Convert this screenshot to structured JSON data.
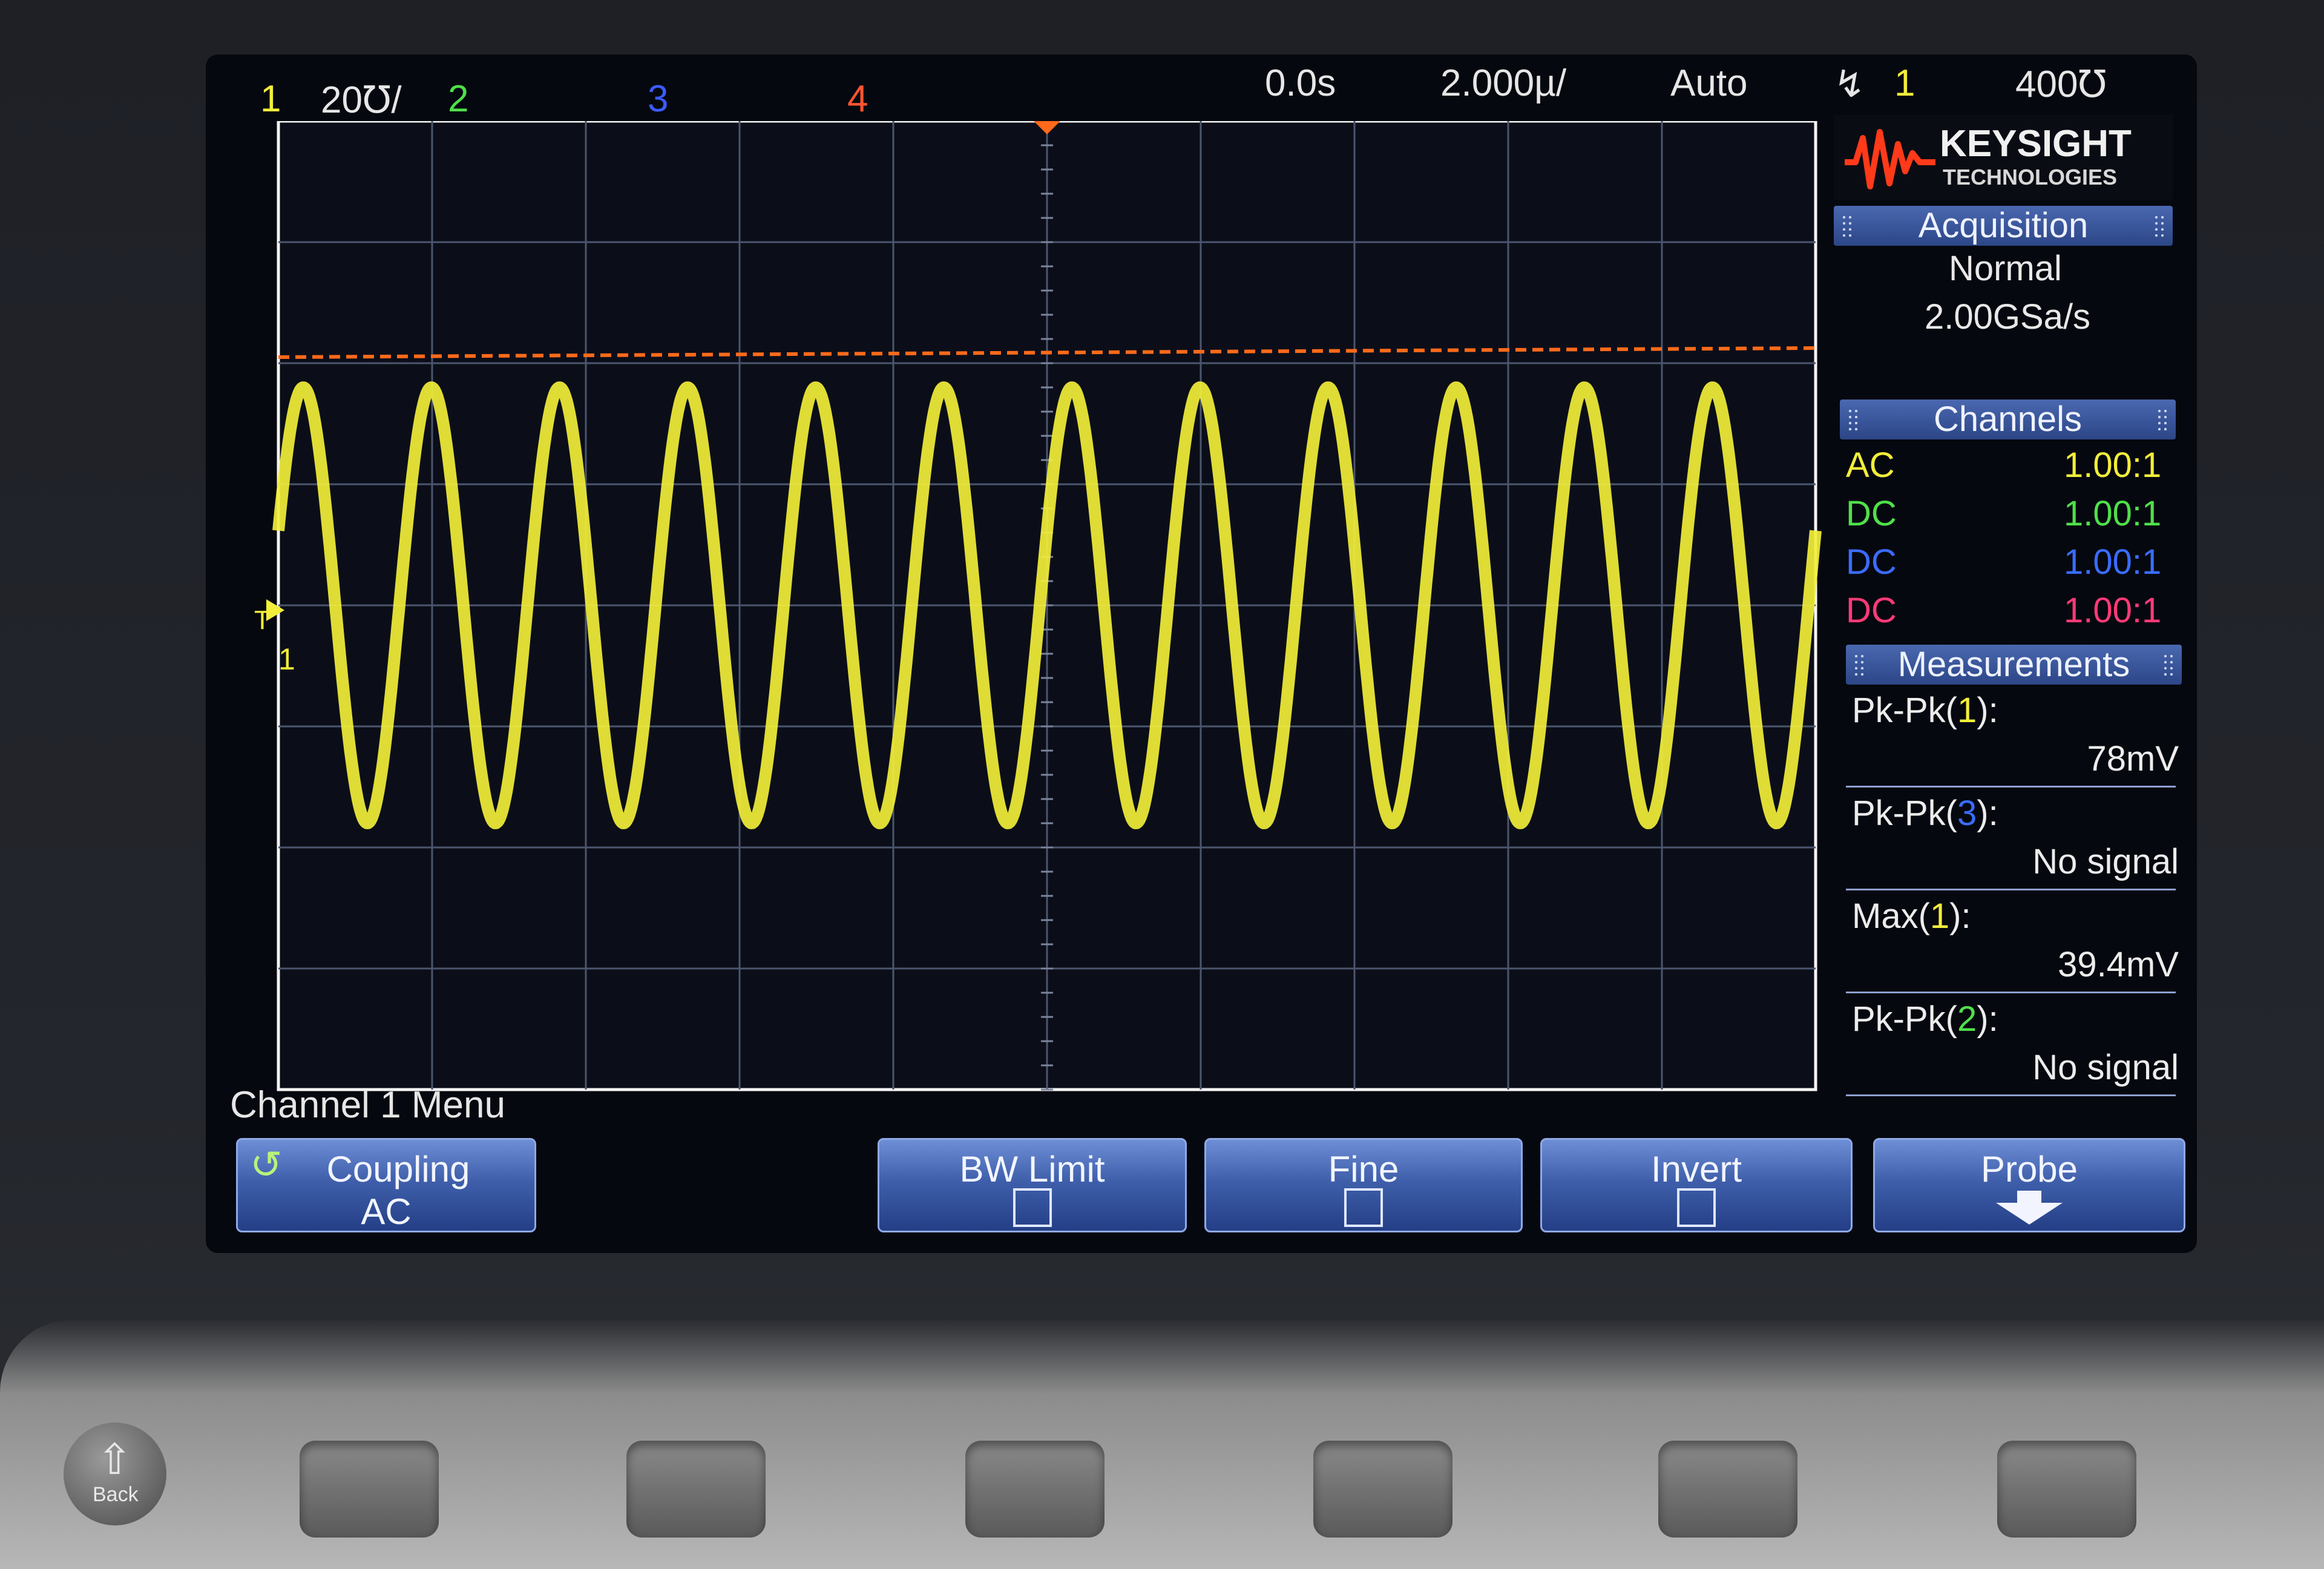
{
  "status_bar": {
    "ch1_num": "1",
    "ch1_scale": "20℧/",
    "ch2_num": "2",
    "ch3_num": "3",
    "ch4_num": "4",
    "time_delay": "0.0s",
    "time_scale": "2.000µ/",
    "trigger_mode": "Auto",
    "trigger_source": "1",
    "trigger_level": "400℧",
    "colors": {
      "ch1": "#f2ee3a",
      "ch2": "#4fe04a",
      "ch3": "#3a5cff",
      "ch4": "#ff5530"
    }
  },
  "branding": {
    "name": "KEYSIGHT",
    "sub": "TECHNOLOGIES"
  },
  "acquisition": {
    "header": "Acquisition",
    "mode": "Normal",
    "rate": "2.00GSa/s"
  },
  "channels": {
    "header": "Channels",
    "rows": [
      {
        "coupling": "AC",
        "probe": "1.00:1",
        "color": "#f2ee3a"
      },
      {
        "coupling": "DC",
        "probe": "1.00:1",
        "color": "#4fe04a"
      },
      {
        "coupling": "DC",
        "probe": "1.00:1",
        "color": "#3a6cff"
      },
      {
        "coupling": "DC",
        "probe": "1.00:1",
        "color": "#ff3a78"
      }
    ]
  },
  "measurements": {
    "header": "Measurements",
    "items": [
      {
        "label_pre": "Pk-Pk(",
        "ch": "1",
        "label_post": "):",
        "value": "78mV",
        "ch_color": "#f2ee3a"
      },
      {
        "label_pre": "Pk-Pk(",
        "ch": "3",
        "label_post": "):",
        "value": "No signal",
        "ch_color": "#3a6cff"
      },
      {
        "label_pre": "Max(",
        "ch": "1",
        "label_post": "):",
        "value": "39.4mV",
        "ch_color": "#f2ee3a"
      },
      {
        "label_pre": "Pk-Pk(",
        "ch": "2",
        "label_post": "):",
        "value": "No signal",
        "ch_color": "#4fe04a"
      }
    ]
  },
  "waveform": {
    "cycles_on_screen": 12,
    "trigger_level_color": "#ff6a1a",
    "trace_color": "#f2ee3a",
    "ground_marker": "1",
    "trigger_marker": "T"
  },
  "menu": {
    "title": "Channel 1 Menu",
    "coupling_label": "Coupling",
    "coupling_value": "AC",
    "bw_limit_label": "BW Limit",
    "fine_label": "Fine",
    "invert_label": "Invert",
    "probe_label": "Probe"
  },
  "hardware": {
    "back_label": "Back"
  }
}
